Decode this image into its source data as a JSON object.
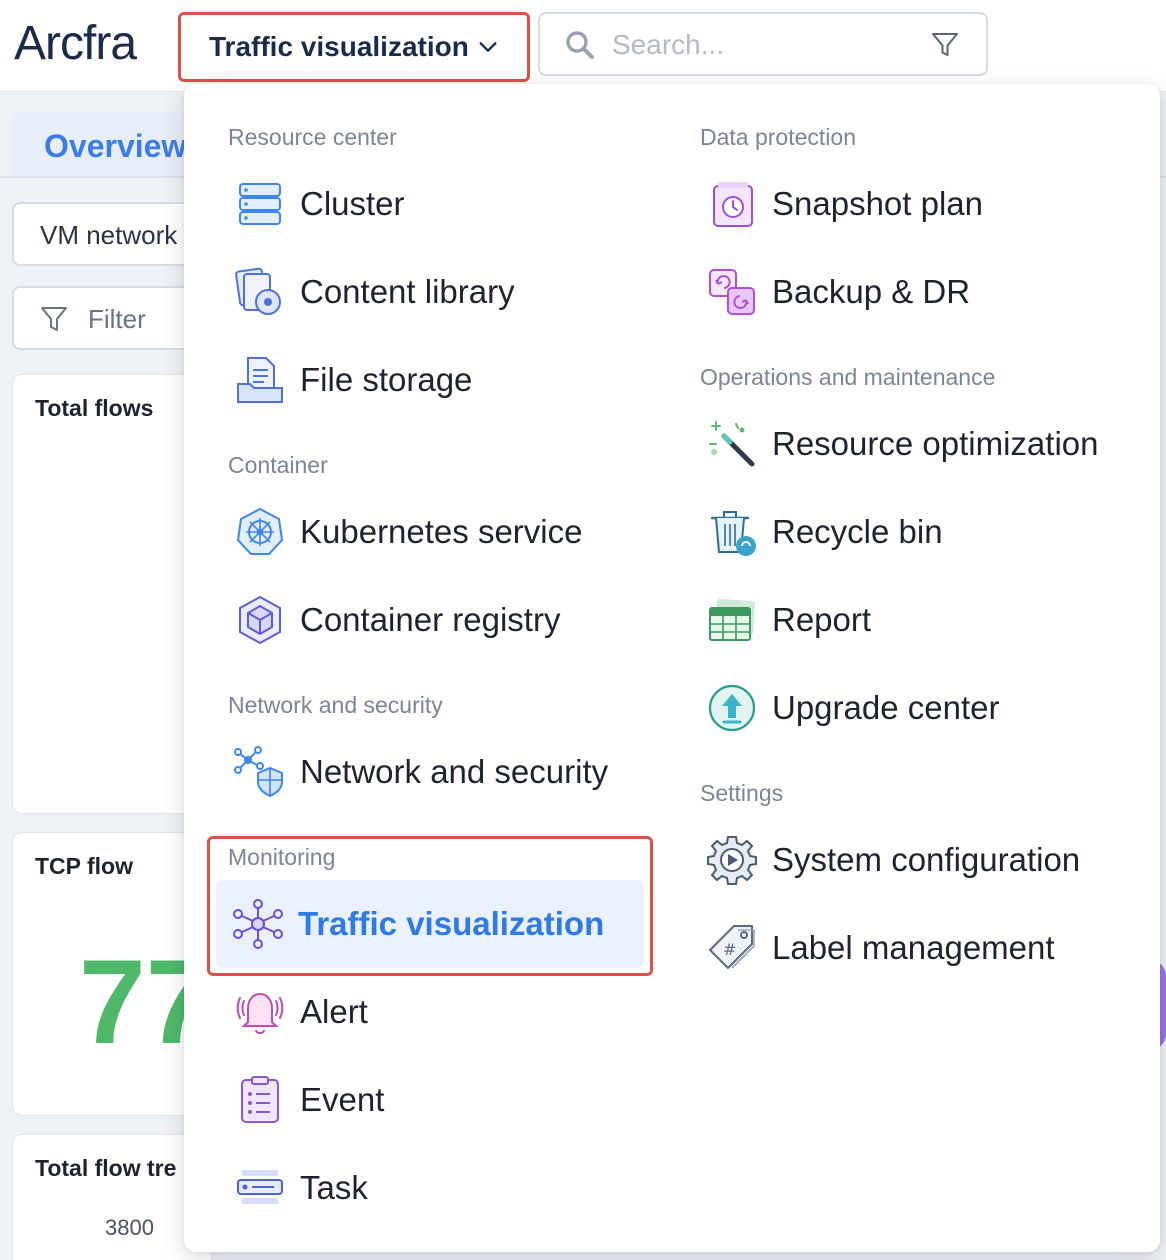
{
  "brand": {
    "logo_text": "Arcfra"
  },
  "header": {
    "nav_label": "Traffic visualization",
    "search_placeholder": "Search..."
  },
  "background": {
    "tab_label": "Overview",
    "select_value": "VM network",
    "filter_label": "Filter",
    "card_total_title": "Total flows",
    "card_tcp_title": "TCP flow",
    "card_tcp_value": "77",
    "card_trend_title": "Total flow tre",
    "card_trend_tick": "3800"
  },
  "menu": {
    "resource_center": {
      "title": "Resource center",
      "items": [
        "Cluster",
        "Content library",
        "File storage"
      ]
    },
    "container": {
      "title": "Container",
      "items": [
        "Kubernetes service",
        "Container registry"
      ]
    },
    "network": {
      "title": "Network and security",
      "items": [
        "Network and security"
      ]
    },
    "monitoring": {
      "title": "Monitoring",
      "items": [
        "Traffic visualization",
        "Alert",
        "Event",
        "Task"
      ],
      "active_index": 0
    },
    "data_protection": {
      "title": "Data protection",
      "items": [
        "Snapshot plan",
        "Backup & DR"
      ]
    },
    "operations": {
      "title": "Operations and maintenance",
      "items": [
        "Resource optimization",
        "Recycle bin",
        "Report",
        "Upgrade center"
      ]
    },
    "settings": {
      "title": "Settings",
      "items": [
        "System configuration",
        "Label management"
      ]
    }
  },
  "colors": {
    "accent": "#2f7ae5",
    "highlight_border": "#d9534a",
    "active_bg": "#eaf1fc",
    "tcp_value": "#4fb86a"
  }
}
